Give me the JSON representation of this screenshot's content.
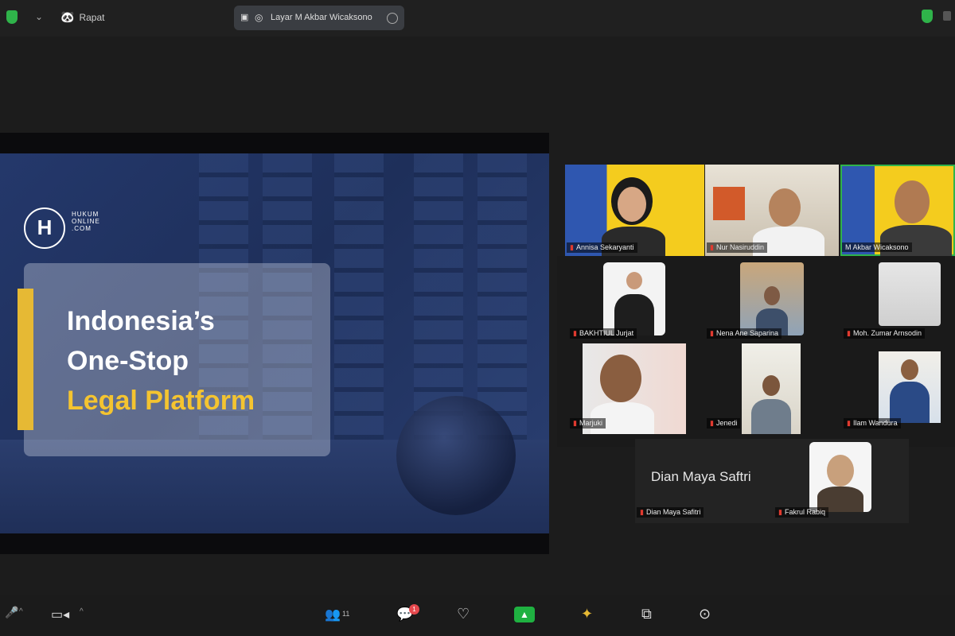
{
  "topbar": {
    "view_label": "Rapat",
    "view_icon": "🐼",
    "chevron": "⌄",
    "speaker_pill": "Layar M Akbar Wicaksono"
  },
  "slide": {
    "logo_letter": "H",
    "logo_text": "HUKUM ONLINE .COM",
    "title_line1": "Indonesia’s",
    "title_line2": "One-Stop",
    "title_line3": "Legal Platform"
  },
  "participants": {
    "p1": "Annisa Sekaryanti",
    "p2": "Nur Nasiruddin",
    "p3": "M Akbar Wicaksono",
    "p4": "BAKHTIUL Jurjat",
    "p5": "Nena Ane Saparina",
    "p6": "Moh. Zumar Arnsodin",
    "p7": "Marjuki",
    "p8": "Jenedi",
    "p9": "Ilam Wandura",
    "p10": "Dian Maya Safitri",
    "p11": "Fakrul Rabiq"
  },
  "dian_big_name": "Dian Maya Saftri",
  "toolbar": {
    "participants_count": "11",
    "chat_badge": "1"
  },
  "colors": {
    "accent_gold": "#f4c430",
    "share_green": "#1fb141",
    "active_border": "#2fb34a"
  }
}
